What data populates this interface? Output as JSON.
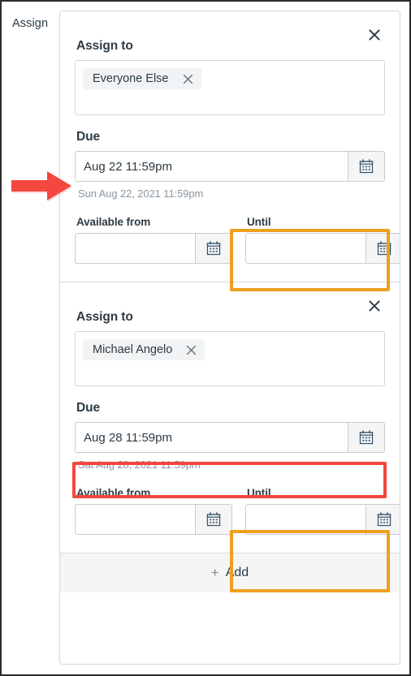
{
  "gutter": {
    "label": "Assign"
  },
  "cards": [
    {
      "close_icon": "close-icon",
      "assign_to_label": "Assign to",
      "token": {
        "label": "Everyone Else",
        "remove_icon": "close-icon"
      },
      "due_label": "Due",
      "due_value": "Aug 22 11:59pm",
      "due_placeholder": "",
      "due_helper": "Sun Aug 22, 2021 11:59pm",
      "available_from_label": "Available from",
      "available_from_value": "",
      "available_from_placeholder": "",
      "until_label": "Until",
      "until_value": "",
      "until_placeholder": "",
      "calendar_icon": "calendar-icon"
    },
    {
      "close_icon": "close-icon",
      "assign_to_label": "Assign to",
      "token": {
        "label": "Michael Angelo",
        "remove_icon": "close-icon"
      },
      "due_label": "Due",
      "due_value": "Aug 28 11:59pm",
      "due_placeholder": "",
      "due_helper": "Sat Aug 28, 2021 11:59pm",
      "available_from_label": "Available from",
      "available_from_value": "",
      "available_from_placeholder": "",
      "until_label": "Until",
      "until_value": "",
      "until_placeholder": "",
      "calendar_icon": "calendar-icon"
    }
  ],
  "footer": {
    "add_label": "Add",
    "add_plus": "+"
  },
  "annotations": {
    "highlight_orange": "#eda01f",
    "highlight_red": "#f4473f",
    "arrow_color": "#f4473f"
  }
}
